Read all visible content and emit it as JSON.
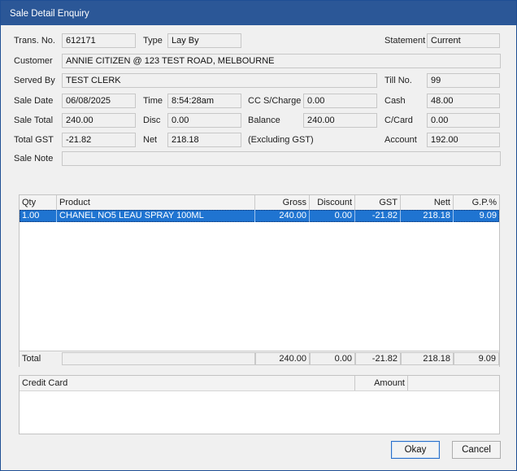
{
  "window": {
    "title": "Sale Detail Enquiry"
  },
  "labels": {
    "trans_no": "Trans. No.",
    "type": "Type",
    "statement": "Statement",
    "customer": "Customer",
    "served_by": "Served By",
    "till_no": "Till No.",
    "sale_date": "Sale Date",
    "time": "Time",
    "cc_surcharge": "CC S/Charge",
    "cash": "Cash",
    "sale_total": "Sale Total",
    "disc": "Disc",
    "balance": "Balance",
    "ccard": "C/Card",
    "total_gst": "Total GST",
    "net": "Net",
    "excluding_gst": "(Excluding GST)",
    "account": "Account",
    "sale_note": "Sale Note"
  },
  "fields": {
    "trans_no": "612171",
    "type": "Lay By",
    "statement": "Current",
    "customer": "ANNIE CITIZEN @ 123 TEST ROAD, MELBOURNE",
    "served_by": "TEST CLERK",
    "till_no": "99",
    "sale_date": "06/08/2025",
    "time": "8:54:28am",
    "cc_surcharge": "0.00",
    "cash": "48.00",
    "sale_total": "240.00",
    "disc": "0.00",
    "balance": "240.00",
    "ccard": "0.00",
    "total_gst": "-21.82",
    "net": "218.18",
    "account": "192.00",
    "sale_note": ""
  },
  "items_grid": {
    "columns": [
      "Qty",
      "Product",
      "Gross",
      "Discount",
      "GST",
      "Nett",
      "G.P.%"
    ],
    "rows": [
      {
        "qty": "1.00",
        "product": "CHANEL NO5 LEAU SPRAY 100ML",
        "gross": "240.00",
        "discount": "0.00",
        "gst": "-21.82",
        "nett": "218.18",
        "gp": "9.09"
      }
    ],
    "totals": {
      "label": "Total",
      "gross": "240.00",
      "discount": "0.00",
      "gst": "-21.82",
      "nett": "218.18",
      "gp": "9.09"
    },
    "selected_row_color": "#1f74d1"
  },
  "credit_grid": {
    "columns": [
      "Credit Card",
      "Amount"
    ]
  },
  "buttons": {
    "okay": "Okay",
    "cancel": "Cancel"
  },
  "colors": {
    "titlebar": "#2b5797",
    "default_button_border": "#2a6fc9"
  }
}
